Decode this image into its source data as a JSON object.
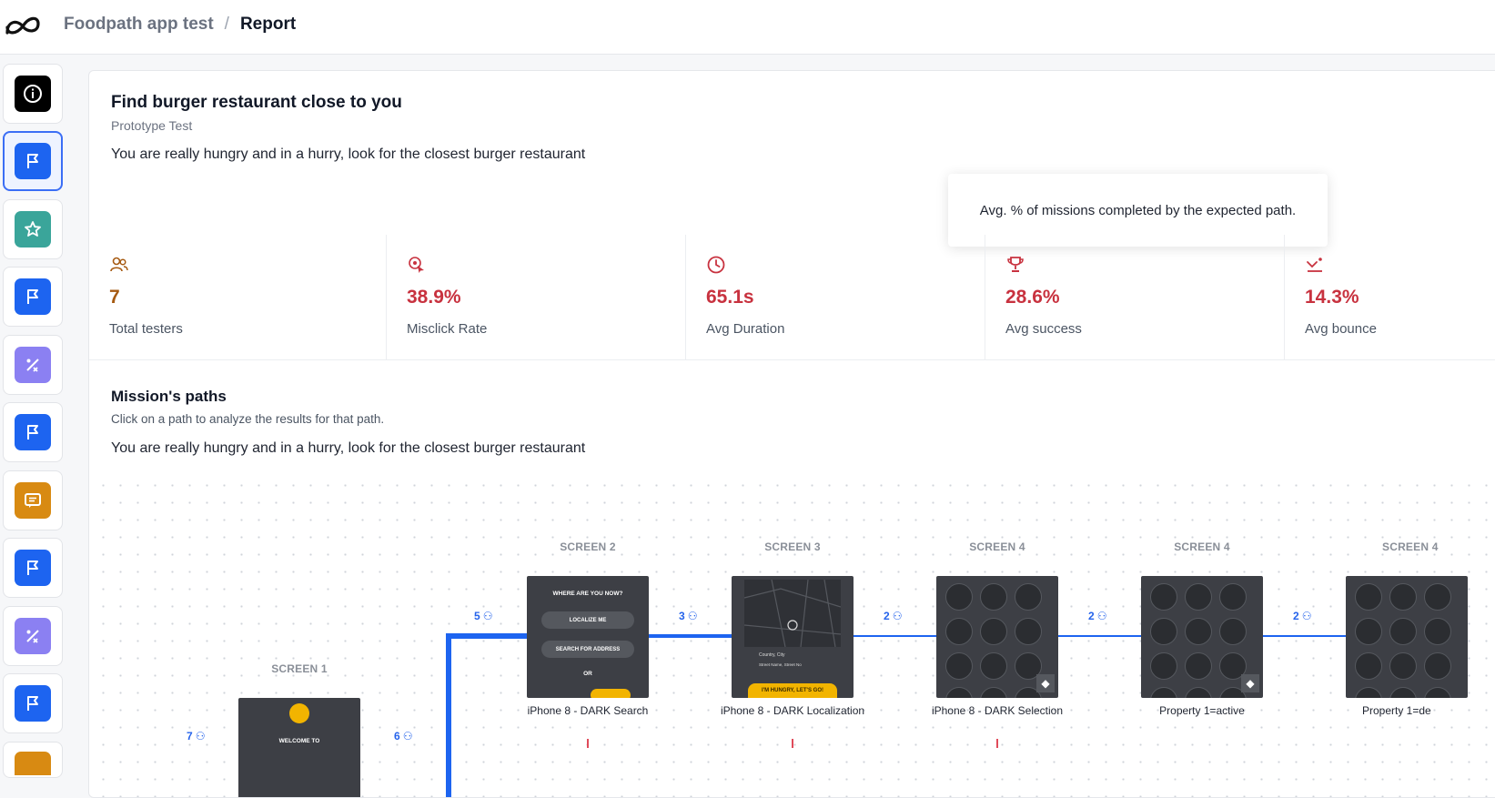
{
  "breadcrumb": {
    "project": "Foodpath app test",
    "separator": "/",
    "page": "Report"
  },
  "sidebar": {
    "items": [
      {
        "name": "info",
        "color": "#000000",
        "icon": "info-icon"
      },
      {
        "name": "mission",
        "color": "#1d64f0",
        "icon": "flag-icon",
        "active": true
      },
      {
        "name": "rating",
        "color": "#3aa59a",
        "icon": "star-icon"
      },
      {
        "name": "mission",
        "color": "#1d64f0",
        "icon": "flag-icon"
      },
      {
        "name": "percent",
        "color": "#8b80f2",
        "icon": "percent-icon"
      },
      {
        "name": "mission",
        "color": "#1d64f0",
        "icon": "flag-icon"
      },
      {
        "name": "open-question",
        "color": "#d88a12",
        "icon": "message-icon"
      },
      {
        "name": "mission",
        "color": "#1d64f0",
        "icon": "flag-icon"
      },
      {
        "name": "percent",
        "color": "#8b80f2",
        "icon": "percent-icon"
      },
      {
        "name": "mission",
        "color": "#1d64f0",
        "icon": "flag-icon"
      }
    ]
  },
  "mission": {
    "title": "Find burger restaurant close to you",
    "type": "Prototype Test",
    "description": "You are really hungry and in a hurry, look for the closest burger restaurant"
  },
  "tooltip": {
    "text": "Avg. % of missions completed by the expected path."
  },
  "stats": [
    {
      "value": "7",
      "label": "Total testers",
      "color": "#a65a12",
      "icon": "users-icon"
    },
    {
      "value": "38.9%",
      "label": "Misclick Rate",
      "color": "#c8323f",
      "icon": "misclick-icon"
    },
    {
      "value": "65.1s",
      "label": "Avg Duration",
      "color": "#c8323f",
      "icon": "clock-icon"
    },
    {
      "value": "28.6%",
      "label": "Avg success",
      "color": "#c8323f",
      "icon": "trophy-icon"
    },
    {
      "value": "14.3%",
      "label": "Avg bounce",
      "color": "#c8323f",
      "icon": "bounce-icon"
    }
  ],
  "paths": {
    "title": "Mission's paths",
    "subtitle": "Click on a path to analyze the results for that path.",
    "description": "You are really hungry and in a hurry, look for the closest burger restaurant",
    "screens": [
      {
        "label": "SCREEN 1",
        "caption": "",
        "thumb_text": "WELCOME TO"
      },
      {
        "label": "SCREEN 2",
        "caption": "iPhone 8 - DARK Search",
        "thumb_text": "WHERE ARE YOU NOW?",
        "pills": [
          "LOCALIZE ME",
          "SEARCH FOR ADDRESS"
        ],
        "or": "OR"
      },
      {
        "label": "SCREEN 3",
        "caption": "iPhone 8 - DARK Localization",
        "addr1": "Country, City",
        "addr2": "Street Name, Street No",
        "button": "I'M HUNGRY, LET'S GO!"
      },
      {
        "label": "SCREEN 4",
        "caption": "iPhone 8 - DARK Selection"
      },
      {
        "label": "SCREEN 4",
        "caption": "Property 1=active"
      },
      {
        "label": "SCREEN 4",
        "caption": "Property 1=de"
      }
    ],
    "counts": [
      "7",
      "6",
      "5",
      "3",
      "2",
      "2",
      "2"
    ]
  }
}
